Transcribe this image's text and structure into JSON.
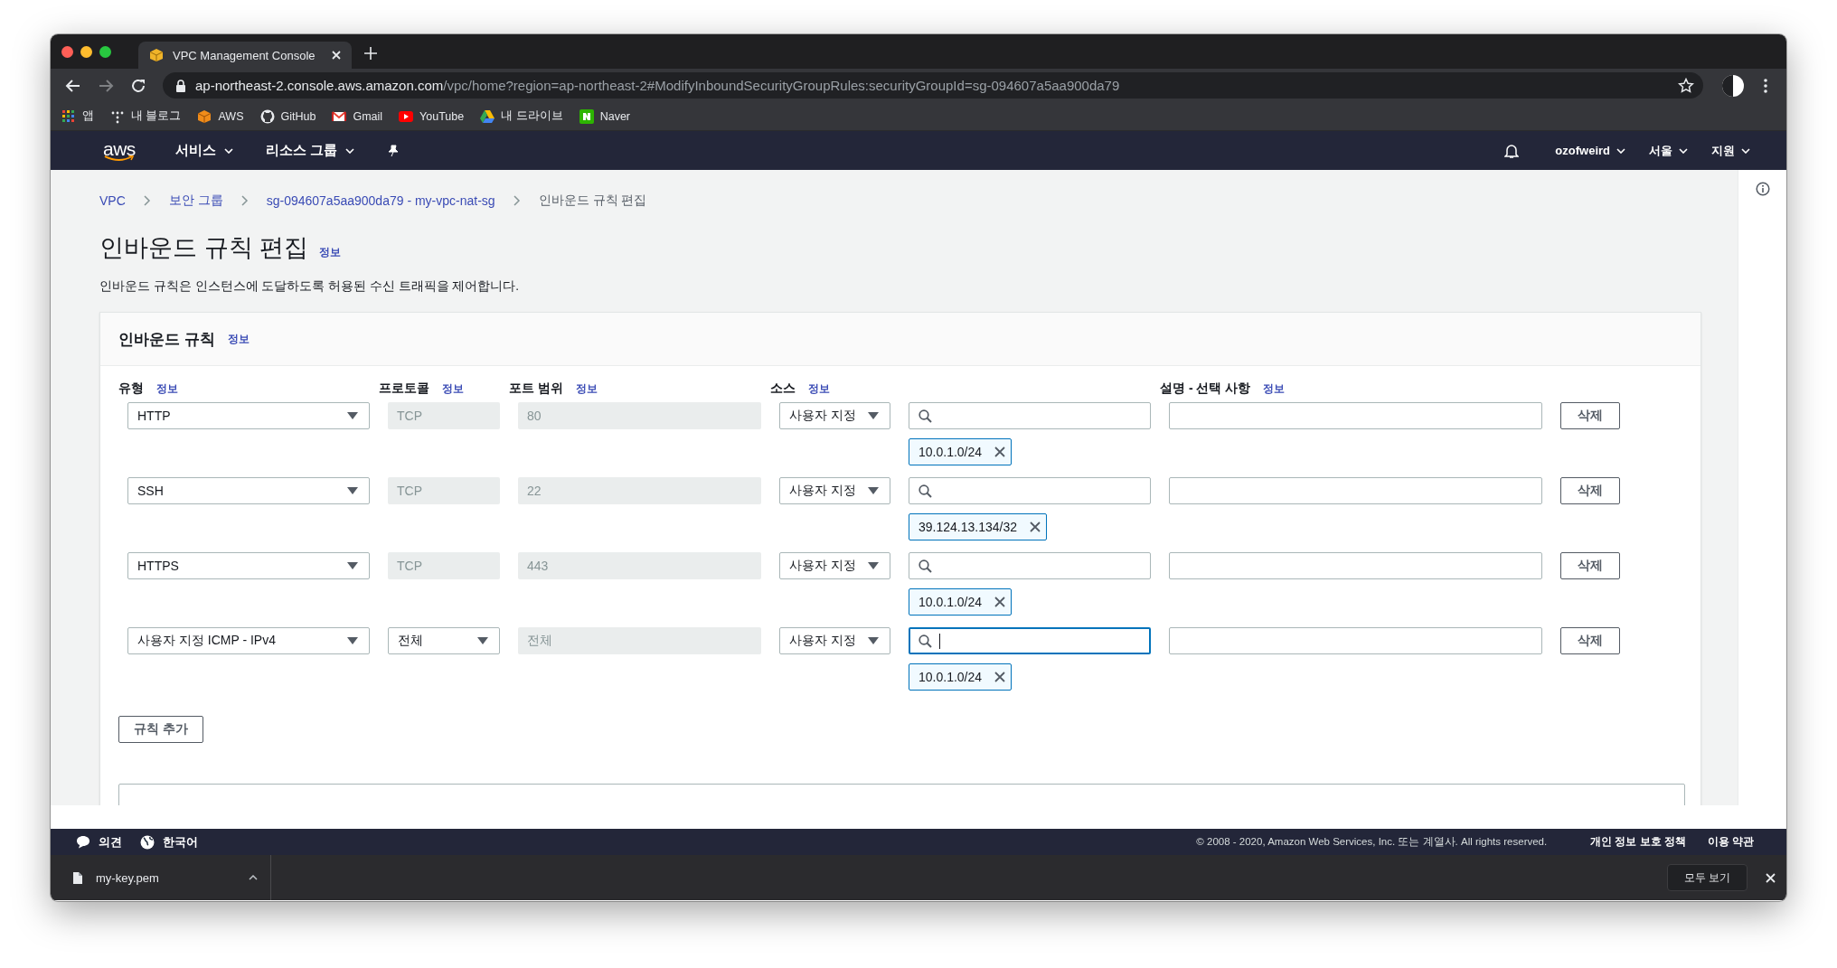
{
  "browser": {
    "tab": {
      "title": "VPC Management Console"
    },
    "address": {
      "host": "ap-northeast-2.console.aws.amazon.com",
      "path": "/vpc/home?region=ap-northeast-2#ModifyInboundSecurityGroupRules:securityGroupId=sg-094607a5aa900da79"
    },
    "bookmarks": [
      {
        "kind": "apps",
        "label": "앱"
      },
      {
        "kind": "blog",
        "label": "내 블로그"
      },
      {
        "kind": "aws",
        "label": "AWS"
      },
      {
        "kind": "github",
        "label": "GitHub"
      },
      {
        "kind": "gmail",
        "label": "Gmail"
      },
      {
        "kind": "youtube",
        "label": "YouTube"
      },
      {
        "kind": "drive",
        "label": "내 드라이브"
      },
      {
        "kind": "naver",
        "label": "Naver"
      }
    ]
  },
  "console_header": {
    "logo": "aws",
    "menus": [
      "서비스",
      "리소스 그룹"
    ],
    "right_menus": [
      "ozofweird",
      "서울",
      "지원"
    ]
  },
  "breadcrumb": [
    {
      "label": "VPC",
      "link": true
    },
    {
      "label": "보안 그룹",
      "link": true
    },
    {
      "label": "sg-094607a5aa900da79 - my-vpc-nat-sg",
      "link": true
    },
    {
      "label": "인바운드 규칙 편집",
      "link": false
    }
  ],
  "page": {
    "title": "인바운드 규칙 편집",
    "info": "정보",
    "description": "인바운드 규칙은 인스턴스에 도달하도록 허용된 수신 트래픽을 제어합니다."
  },
  "panel": {
    "title": "인바운드 규칙",
    "info": "정보",
    "columns": [
      {
        "label": "유형",
        "info": "정보"
      },
      {
        "label": "프로토콜",
        "info": "정보"
      },
      {
        "label": "포트 범위",
        "info": "정보"
      },
      {
        "label": "소스",
        "info": "정보"
      },
      {
        "label": "설명 - 선택 사항",
        "info": "정보"
      }
    ],
    "rules": [
      {
        "type": "HTTP",
        "protocol": {
          "kind": "fixed",
          "value": "TCP"
        },
        "port": "80",
        "source": "사용자 지정",
        "chip": "10.0.1.0/24",
        "focused": false,
        "delete": "삭제"
      },
      {
        "type": "SSH",
        "protocol": {
          "kind": "fixed",
          "value": "TCP"
        },
        "port": "22",
        "source": "사용자 지정",
        "chip": "39.124.13.134/32",
        "focused": false,
        "delete": "삭제"
      },
      {
        "type": "HTTPS",
        "protocol": {
          "kind": "fixed",
          "value": "TCP"
        },
        "port": "443",
        "source": "사용자 지정",
        "chip": "10.0.1.0/24",
        "focused": false,
        "delete": "삭제"
      },
      {
        "type": "사용자 지정 ICMP - IPv4",
        "protocol": {
          "kind": "select",
          "value": "전체"
        },
        "port": "전체",
        "source": "사용자 지정",
        "chip": "10.0.1.0/24",
        "focused": true,
        "delete": "삭제"
      }
    ],
    "add_button": "규칙 추가"
  },
  "footer": {
    "feedback": "의견",
    "language": "한국어",
    "copyright": "© 2008 - 2020, Amazon Web Services, Inc. 또는 계열사. All rights reserved.",
    "links": [
      "개인 정보 보호 정책",
      "이용 약관"
    ]
  },
  "downloads": {
    "file": "my-key.pem",
    "show_all": "모두 보기"
  }
}
